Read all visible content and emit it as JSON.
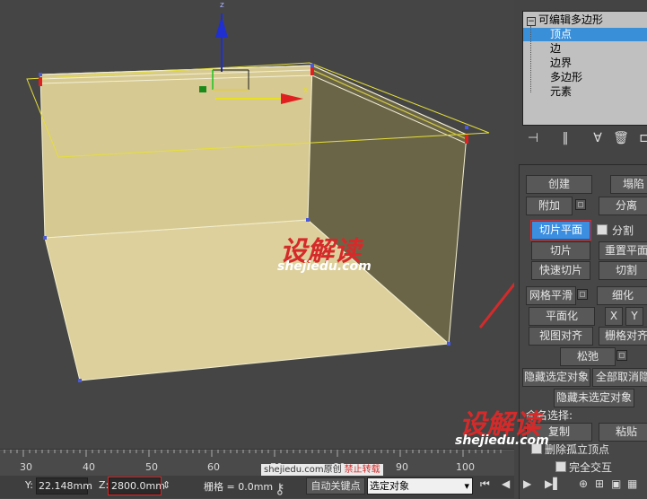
{
  "viewport": {
    "axis_label": "z",
    "gizmo_x_label": "x",
    "watermark_cn": "设解读",
    "watermark_en": "shejiedu.com"
  },
  "stack": {
    "root": "可编辑多边形",
    "items": [
      "顶点",
      "边",
      "边界",
      "多边形",
      "元素"
    ],
    "selected_index": 0
  },
  "toolbar": {
    "icons": [
      "pin-stack-icon",
      "show-end-result-icon",
      "make-unique-icon",
      "remove-modifier-icon",
      "configure-sets-icon"
    ]
  },
  "edit_geometry": {
    "create": "创建",
    "collapse": "塌陷",
    "attach": "附加",
    "detach": "分离",
    "slice_plane": "切片平面",
    "split": "分割",
    "slice": "切片",
    "reset_plane": "重置平面",
    "quick_slice": "快速切片",
    "cut": "切割",
    "msmooth": "网格平滑",
    "tessellate": "细化",
    "make_planar": "平面化",
    "x": "X",
    "y": "Y",
    "view_align": "视图对齐",
    "grid_align": "栅格对齐",
    "relax": "松弛",
    "hide_selected": "隐藏选定对象",
    "unhide_all": "全部取消隐",
    "hide_unselected": "隐藏未选定对象",
    "named_selections": "命名选择:",
    "copy": "复制",
    "paste": "粘贴",
    "delete_isolated": "删除孤立顶点",
    "full_interactivity": "完全交互"
  },
  "timeline": {
    "ticks": [
      "30",
      "40",
      "50",
      "60",
      "70",
      "80",
      "90",
      "100"
    ]
  },
  "status": {
    "y_label": "Y:",
    "y_value": "22.148mm",
    "z_label": "Z:",
    "z_value": "2800.0mm",
    "grid": "栅格 = 0.0mm",
    "auto_key": "自动关键点",
    "selection_set": "选定对象",
    "watermark_site": "shejiedu.com原创",
    "watermark_warn": "禁止转载"
  },
  "colors": {
    "viewport_bg": "#454545",
    "wall_fill": "#d8cb95",
    "wall_shade": "#6a6448",
    "selection_blue": "#3b8ee0",
    "annotation_red": "#d62a2a"
  }
}
